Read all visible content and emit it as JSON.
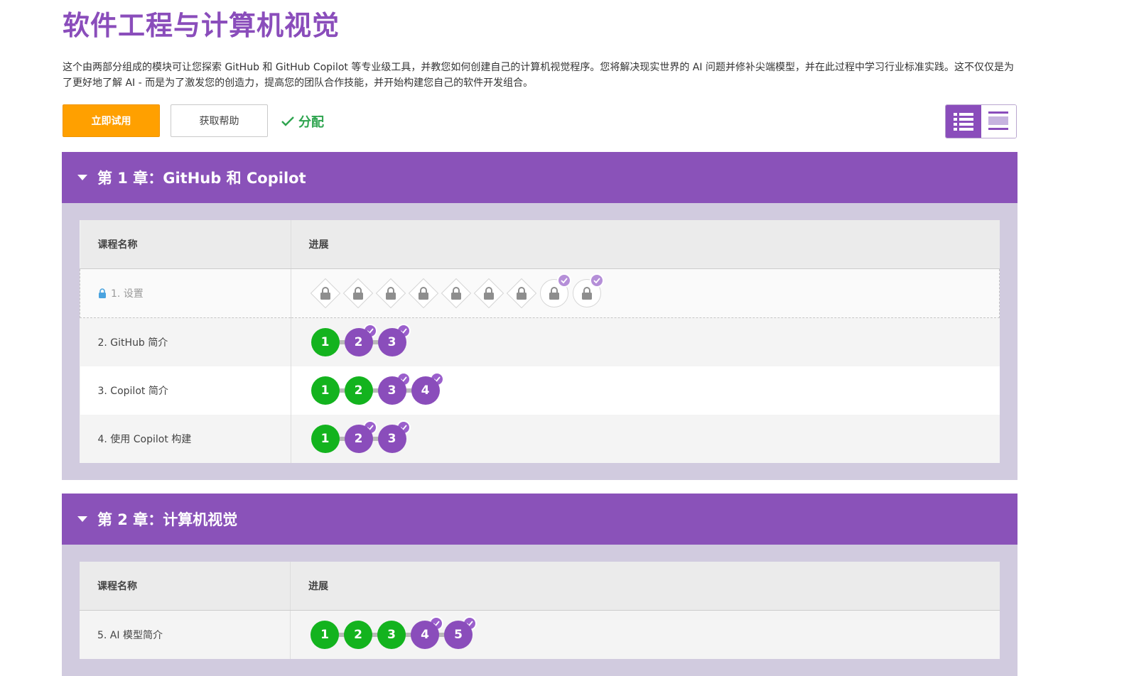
{
  "course": {
    "title": "软件工程与计算机视觉",
    "description": "这个由两部分组成的模块可让您探索 GitHub 和 GitHub Copilot 等专业级工具，并教您如何创建自己的计算机视觉程序。您将解决现实世界的 AI 问题并修补尖端模型，并在此过程中学习行业标准实践。这不仅仅是为了更好地了解 AI - 而是为了激发您的创造力，提高您的团队合作技能，并开始构建您自己的软件开发组合。"
  },
  "actions": {
    "try_label": "立即试用",
    "help_label": "获取帮助",
    "assigned_label": "分配"
  },
  "view_toggle": {
    "active": "list-view"
  },
  "table_headers": {
    "lesson_name": "课程名称",
    "progress": "进展"
  },
  "chapters": [
    {
      "title": "第 1 章：GitHub 和 Copilot",
      "lessons": [
        {
          "name": "1. 设置",
          "locked": true,
          "levels": [
            {
              "shape": "diamond",
              "checked": false
            },
            {
              "shape": "diamond",
              "checked": false
            },
            {
              "shape": "diamond",
              "checked": false
            },
            {
              "shape": "diamond",
              "checked": false
            },
            {
              "shape": "diamond",
              "checked": false
            },
            {
              "shape": "diamond",
              "checked": false
            },
            {
              "shape": "diamond",
              "checked": false
            },
            {
              "shape": "circle",
              "checked": true
            },
            {
              "shape": "circle",
              "checked": true
            }
          ]
        },
        {
          "name": "2. GitHub 简介",
          "locked": false,
          "levels": [
            {
              "n": "1",
              "state": "done"
            },
            {
              "n": "2",
              "state": "assessment"
            },
            {
              "n": "3",
              "state": "assessment"
            }
          ]
        },
        {
          "name": "3. Copilot 简介",
          "locked": false,
          "levels": [
            {
              "n": "1",
              "state": "done"
            },
            {
              "n": "2",
              "state": "done"
            },
            {
              "n": "3",
              "state": "assessment"
            },
            {
              "n": "4",
              "state": "assessment"
            }
          ]
        },
        {
          "name": "4. 使用 Copilot 构建",
          "locked": false,
          "levels": [
            {
              "n": "1",
              "state": "done"
            },
            {
              "n": "2",
              "state": "assessment"
            },
            {
              "n": "3",
              "state": "assessment"
            }
          ]
        }
      ]
    },
    {
      "title": "第 2 章：计算机视觉",
      "lessons": [
        {
          "name": "5. AI 模型简介",
          "locked": false,
          "levels": [
            {
              "n": "1",
              "state": "done"
            },
            {
              "n": "2",
              "state": "done"
            },
            {
              "n": "3",
              "state": "done"
            },
            {
              "n": "4",
              "state": "assessment"
            },
            {
              "n": "5",
              "state": "assessment"
            }
          ]
        }
      ]
    }
  ],
  "colors": {
    "brand_purple": "#8a52b9",
    "title_purple": "#8a4dbb",
    "orange": "#ffa000",
    "done_green": "#13b31e",
    "assigned_green": "#2ea44f",
    "chapter_bg": "#d1cbdf"
  }
}
